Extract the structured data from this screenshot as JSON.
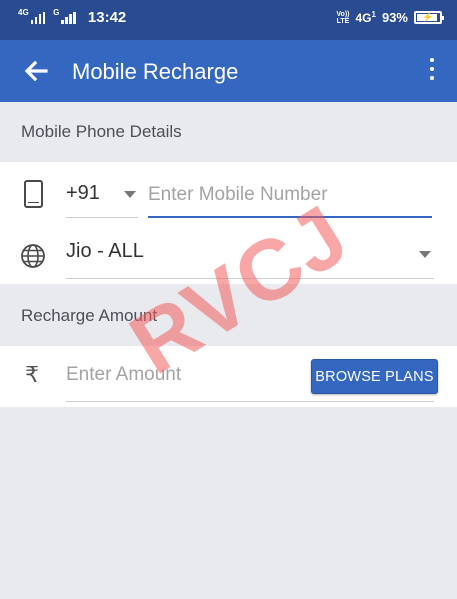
{
  "status_bar": {
    "sim1_network": "4G",
    "sim2_network": "G",
    "time": "13:42",
    "volte_line1": "Vo))",
    "volte_line2": "LTE",
    "data_network": "4G",
    "data_sim": "1",
    "battery_percent": "93%",
    "battery_level": 0.93,
    "battery_charging": true
  },
  "app_bar": {
    "title": "Mobile Recharge",
    "back_icon": "arrow-left-icon",
    "menu_icon": "more-vertical-icon"
  },
  "phone_details": {
    "section_title": "Mobile Phone Details",
    "phone_icon": "smartphone-icon",
    "country_code": "+91",
    "mobile_number": "",
    "mobile_placeholder": "Enter Mobile Number",
    "operator_icon": "globe-icon",
    "operator": "Jio - ALL"
  },
  "recharge_amount": {
    "section_title": "Recharge Amount",
    "currency_icon": "rupee-icon",
    "currency_symbol": "₹",
    "amount": "",
    "amount_placeholder": "Enter Amount",
    "browse_button": "BROWSE PLANS"
  },
  "watermark": {
    "text": "RVCJ",
    "color": "#f25c5c"
  },
  "colors": {
    "status_bar": "#284b92",
    "app_bar": "#3467c0",
    "background": "#e9eaee",
    "accent": "#3467c0"
  }
}
